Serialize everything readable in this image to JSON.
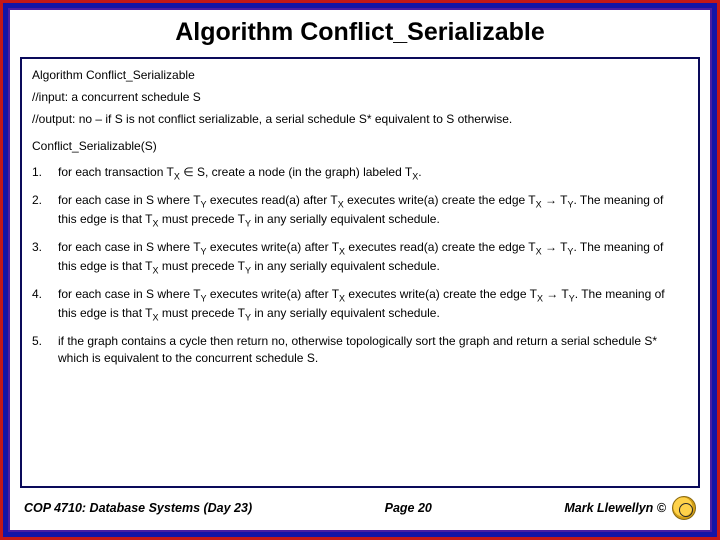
{
  "title": "Algorithm Conflict_Serializable",
  "algo_name": "Algorithm Conflict_Serializable",
  "input_line": "//input:  a concurrent schedule S",
  "output_line": "//output:  no – if S is not conflict serializable, a serial schedule S* equivalent to S otherwise.",
  "fn_header": "Conflict_Serializable(S)",
  "steps": [
    {
      "n": "1.",
      "html": "for each transaction T<span class='sub'>X</span> ∈ S, create a node (in the graph) labeled T<span class='sub'>X</span>."
    },
    {
      "n": "2.",
      "html": "for each case in S where T<span class='sub'>Y</span> executes read(a) after T<span class='sub'>X</span> executes write(a) create the edge T<span class='sub'>X</span> → T<span class='sub'>Y</span>.  The meaning of this edge is that T<span class='sub'>X</span> must precede T<span class='sub'>Y</span> in any serially equivalent schedule."
    },
    {
      "n": "3.",
      "html": "for each case in S where T<span class='sub'>Y</span> executes write(a) after T<span class='sub'>X</span> executes read(a) create the edge T<span class='sub'>X</span> → T<span class='sub'>Y</span>.  The meaning of this edge is that T<span class='sub'>X</span> must precede T<span class='sub'>Y</span> in any serially equivalent schedule."
    },
    {
      "n": "4.",
      "html": "for each case in S where T<span class='sub'>Y</span> executes write(a) after T<span class='sub'>X</span> executes write(a) create the edge T<span class='sub'>X</span> → T<span class='sub'>Y</span>.  The meaning of this edge is that T<span class='sub'>X</span> must precede T<span class='sub'>Y</span> in any serially equivalent schedule."
    },
    {
      "n": "5.",
      "html": "if the graph contains a cycle then return no, otherwise topologically sort the graph and return a serial schedule S* which is equivalent to the concurrent schedule S."
    }
  ],
  "footer": {
    "left": "COP 4710: Database Systems  (Day 23)",
    "mid": "Page 20",
    "right": "Mark Llewellyn ©"
  }
}
